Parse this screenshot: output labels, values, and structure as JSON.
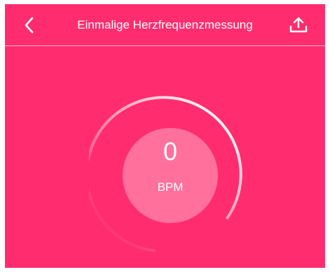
{
  "header": {
    "title": "Einmalige Herzfrequenzmessung",
    "back_icon": "chevron-left-icon",
    "share_icon": "upload-icon"
  },
  "measurement": {
    "value": "0",
    "unit": "BPM"
  },
  "colors": {
    "background": "#ff2d6f",
    "foreground": "#ffffff"
  }
}
